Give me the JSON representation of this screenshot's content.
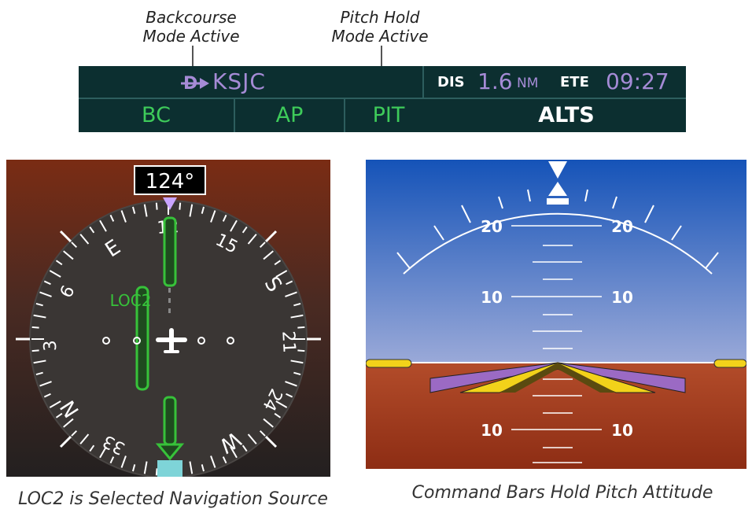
{
  "callouts": {
    "backcourse_line1": "Backcourse",
    "backcourse_line2": "Mode Active",
    "pitch_line1": "Pitch Hold",
    "pitch_line2": "Mode Active"
  },
  "status_bar": {
    "destination": "KSJC",
    "dis_label": "DIS",
    "dis_value": "1.6",
    "dis_unit": "NM",
    "ete_label": "ETE",
    "ete_value": "09:27",
    "modes": {
      "lateral": "BC",
      "autopilot": "AP",
      "vertical": "PIT",
      "armed": "ALTS"
    },
    "colors": {
      "background": "#0c2f30",
      "active_mode": "#3ecb5a",
      "armed_mode": "#ffffff",
      "magenta": "#a58bd6"
    }
  },
  "hsi": {
    "heading": "124°",
    "nav_source": "LOC2",
    "compass_labels": [
      "12",
      "15",
      "S",
      "21",
      "24",
      "W",
      "33",
      "N",
      "3",
      "6",
      "E"
    ]
  },
  "attitude": {
    "pitch_labels": [
      "20",
      "20",
      "10",
      "10",
      "10",
      "10"
    ]
  },
  "captions": {
    "hsi": "LOC2 is Selected Navigation Source",
    "attitude": "Command Bars Hold Pitch Attitude"
  }
}
